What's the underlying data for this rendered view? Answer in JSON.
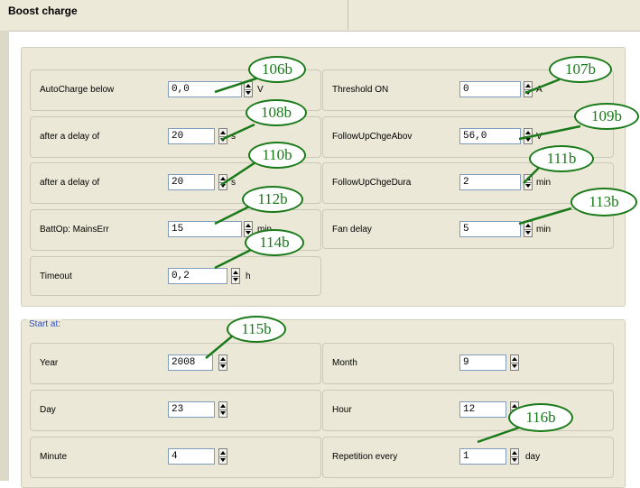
{
  "window": {
    "title": "Boost charge"
  },
  "boost": {
    "autocharge": {
      "label": "AutoCharge below",
      "value": "0,0",
      "unit": "V"
    },
    "delay1": {
      "label": "after a delay of",
      "value": "20",
      "unit": "s"
    },
    "delay2": {
      "label": "after a delay of",
      "value": "20",
      "unit": "s"
    },
    "battop": {
      "label": "BattOp: MainsErr",
      "value": "15",
      "unit": "min"
    },
    "timeout": {
      "label": "Timeout",
      "value": "0,2",
      "unit": "h"
    },
    "threshold": {
      "label": "Threshold ON",
      "value": "0",
      "unit": "A"
    },
    "followabov": {
      "label": "FollowUpChgeAbov",
      "value": "56,0",
      "unit": "V"
    },
    "followdura": {
      "label": "FollowUpChgeDura",
      "value": "2",
      "unit": "min"
    },
    "fandelay": {
      "label": "Fan delay",
      "value": "5",
      "unit": "min"
    }
  },
  "start": {
    "title": "Start at:",
    "year": {
      "label": "Year",
      "value": "2008"
    },
    "month": {
      "label": "Month",
      "value": "9"
    },
    "day": {
      "label": "Day",
      "value": "23"
    },
    "hour": {
      "label": "Hour",
      "value": "12"
    },
    "minute": {
      "label": "Minute",
      "value": "4"
    },
    "repetition": {
      "label": "Repetition every",
      "value": "1",
      "unit": "day"
    }
  },
  "callouts": {
    "c106b": "106b",
    "c107b": "107b",
    "c108b": "108b",
    "c109b": "109b",
    "c110b": "110b",
    "c111b": "111b",
    "c112b": "112b",
    "c113b": "113b",
    "c114b": "114b",
    "c115b": "115b",
    "c116b": "116b"
  },
  "colors": {
    "panel": "#ece9d8",
    "callout": "#1a7a1a",
    "group_title": "#2a4fd0",
    "field_border": "#7f9db9"
  }
}
